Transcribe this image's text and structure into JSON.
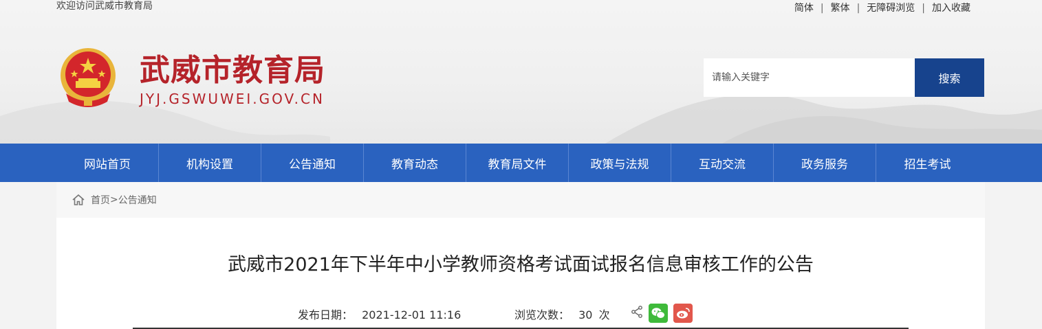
{
  "header": {
    "welcome": "欢迎访问武威市教育局",
    "top_links": [
      "简体",
      "繁体",
      "无障碍浏览",
      "加入收藏"
    ],
    "title": "武威市教育局",
    "domain": "JYJ.GSWUWEI.GOV.CN"
  },
  "search": {
    "placeholder": "请输入关键字",
    "button": "搜索"
  },
  "nav": {
    "items": [
      "网站首页",
      "机构设置",
      "公告通知",
      "教育动态",
      "教育局文件",
      "政策与法规",
      "互动交流",
      "政务服务",
      "招生考试"
    ]
  },
  "breadcrumb": {
    "home": "首页",
    "sep": ">",
    "current": "公告通知"
  },
  "article": {
    "title": "武威市2021年下半年中小学教师资格考试面试报名信息审核工作的公告",
    "publish_label": "发布日期：",
    "publish_date": "2021-12-01 11:16",
    "views_label": "浏览次数：",
    "views_count": "30",
    "views_unit": "次"
  },
  "colors": {
    "brand_red": "#b5232a",
    "nav_blue": "#2a62bf",
    "search_blue": "#17438d",
    "wechat_green": "#3fba3b",
    "weibo_red": "#e2574c"
  },
  "icons": [
    "national-emblem-icon",
    "home-icon",
    "share-icon",
    "wechat-icon",
    "weibo-icon"
  ]
}
